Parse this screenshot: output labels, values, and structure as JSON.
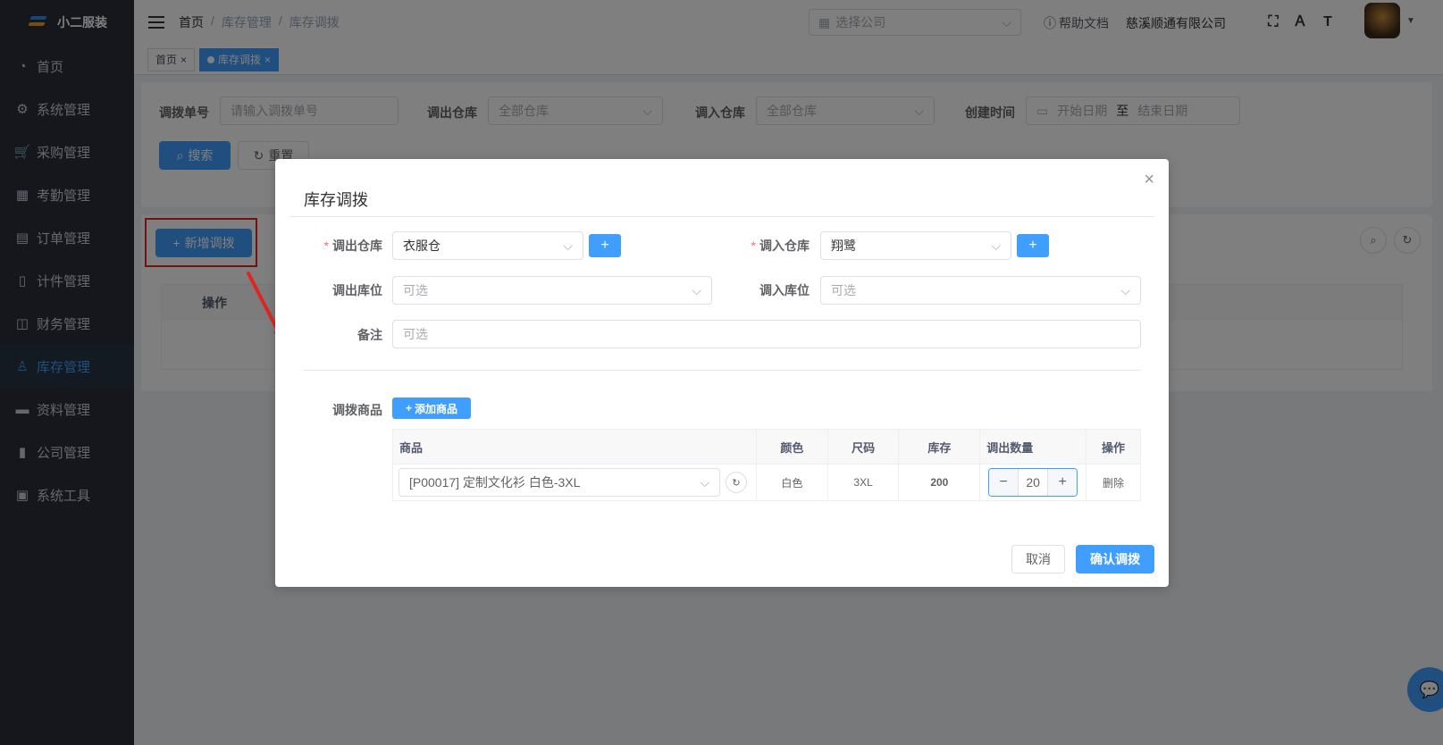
{
  "app": {
    "name": "小二服装"
  },
  "sidebar": {
    "items": [
      {
        "label": "首页",
        "icon": "dashboard-icon"
      },
      {
        "label": "系统管理",
        "icon": "gear-icon"
      },
      {
        "label": "采购管理",
        "icon": "cart-icon"
      },
      {
        "label": "考勤管理",
        "icon": "grid-icon"
      },
      {
        "label": "订单管理",
        "icon": "clipboard-icon"
      },
      {
        "label": "计件管理",
        "icon": "book-icon"
      },
      {
        "label": "财务管理",
        "icon": "chart-icon"
      },
      {
        "label": "库存管理",
        "icon": "user-icon",
        "active": true
      },
      {
        "label": "资料管理",
        "icon": "document-icon"
      },
      {
        "label": "公司管理",
        "icon": "bar-chart-icon"
      },
      {
        "label": "系统工具",
        "icon": "toolbox-icon"
      }
    ]
  },
  "header": {
    "breadcrumb": [
      "首页",
      "/",
      "库存管理",
      "/",
      "库存调拨"
    ],
    "company_placeholder": "选择公司",
    "help": "帮助文档",
    "company_name": "慈溪顺通有限公司"
  },
  "tags": [
    {
      "label": "首页",
      "active": false
    },
    {
      "label": "库存调拨",
      "active": true
    }
  ],
  "search": {
    "no_label": "调拨单号",
    "no_placeholder": "请输入调拨单号",
    "out_label": "调出仓库",
    "out_placeholder": "全部仓库",
    "in_label": "调入仓库",
    "in_placeholder": "全部仓库",
    "time_label": "创建时间",
    "start_placeholder": "开始日期",
    "range_sep": "至",
    "end_placeholder": "结束日期",
    "search_btn": "搜索",
    "reset_btn": "重置"
  },
  "toolbar": {
    "add_btn": "新增调拨"
  },
  "table": {
    "op_header": "操作"
  },
  "dialog": {
    "title": "库存调拨",
    "out_wh_label": "调出仓库",
    "out_wh_value": "衣服仓",
    "in_wh_label": "调入仓库",
    "in_wh_value": "翔鹭",
    "out_loc_label": "调出库位",
    "out_loc_placeholder": "可选",
    "in_loc_label": "调入库位",
    "in_loc_placeholder": "可选",
    "remark_label": "备注",
    "remark_placeholder": "可选",
    "goods_label": "调拨商品",
    "add_goods_btn": "添加商品",
    "columns": [
      "商品",
      "颜色",
      "尺码",
      "库存",
      "调出数量",
      "操作"
    ],
    "rows": [
      {
        "product": "[P00017] 定制文化衫 白色-3XL",
        "color": "白色",
        "size": "3XL",
        "stock": "200",
        "qty": "20",
        "action": "删除"
      }
    ],
    "cancel_btn": "取消",
    "confirm_btn": "确认调拨"
  },
  "colors": {
    "primary": "#409eff",
    "danger": "#f56c6c",
    "success": "#67c23a",
    "sidebar": "#2b2f3a"
  }
}
